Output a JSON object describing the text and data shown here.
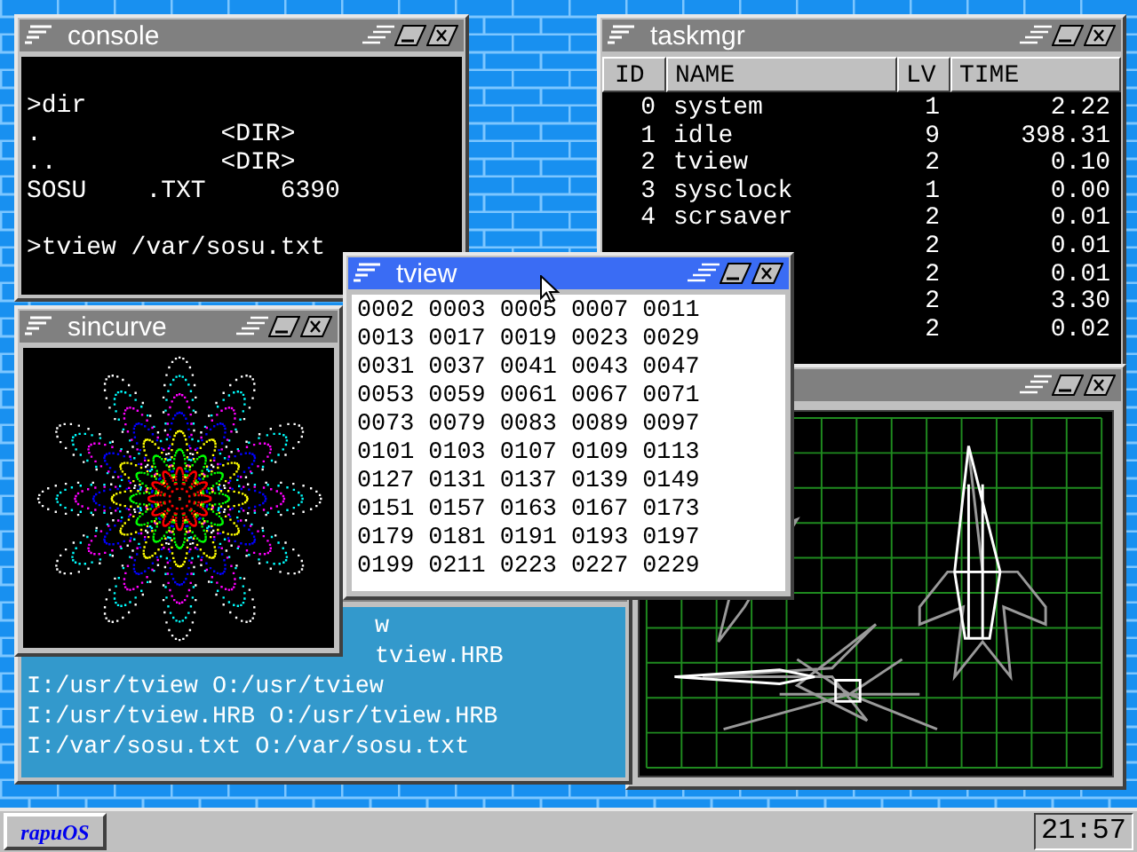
{
  "windows": [
    {
      "kind": "console",
      "title": "console",
      "active": false,
      "blocks": [
        [
          ">dir",
          ".            <DIR>",
          "..           <DIR>",
          "SOSU    .TXT     6390"
        ],
        [
          ">tview /var/sosu.txt"
        ]
      ]
    },
    {
      "kind": "sincurve",
      "title": "sincurve",
      "active": false
    },
    {
      "kind": "log",
      "active": false,
      "lines": [
        {
          "kind": "clipped",
          "text": "w"
        },
        {
          "kind": "clipped",
          "text": "tview.HRB"
        },
        {
          "kind": "full",
          "text": "I:/usr/tview O:/usr/tview"
        },
        {
          "kind": "full",
          "text": "I:/usr/tview.HRB O:/usr/tview.HRB"
        },
        {
          "kind": "full",
          "text": "I:/var/sosu.txt O:/var/sosu.txt"
        }
      ]
    },
    {
      "kind": "tview",
      "title": "tview",
      "active": true,
      "rows": [
        [
          "0002",
          "0003",
          "0005",
          "0007",
          "0011"
        ],
        [
          "0013",
          "0017",
          "0019",
          "0023",
          "0029"
        ],
        [
          "0031",
          "0037",
          "0041",
          "0043",
          "0047"
        ],
        [
          "0053",
          "0059",
          "0061",
          "0067",
          "0071"
        ],
        [
          "0073",
          "0079",
          "0083",
          "0089",
          "0097"
        ],
        [
          "0101",
          "0103",
          "0107",
          "0109",
          "0113"
        ],
        [
          "0127",
          "0131",
          "0137",
          "0139",
          "0149"
        ],
        [
          "0151",
          "0157",
          "0163",
          "0167",
          "0173"
        ],
        [
          "0179",
          "0181",
          "0191",
          "0193",
          "0197"
        ],
        [
          "0199",
          "0211",
          "0223",
          "0227",
          "0229"
        ]
      ]
    },
    {
      "kind": "taskmgr",
      "title": "taskmgr",
      "active": false,
      "columns": [
        "ID",
        "NAME",
        "LV",
        "TIME"
      ],
      "rows": [
        {
          "id": "0",
          "name": "system",
          "lv": "1",
          "time": "2.22"
        },
        {
          "id": "1",
          "name": "idle",
          "lv": "9",
          "time": "398.31"
        },
        {
          "id": "2",
          "name": "tview",
          "lv": "2",
          "time": "0.10"
        },
        {
          "id": "3",
          "name": "sysclock",
          "lv": "1",
          "time": "0.00"
        },
        {
          "id": "4",
          "name": "scrsaver",
          "lv": "2",
          "time": "0.01"
        },
        {
          "lv": "2",
          "time": "0.01"
        },
        {
          "lv": "2",
          "time": "0.01"
        },
        {
          "lv": "2",
          "time": "3.30"
        },
        {
          "lv": "2",
          "time": "0.02"
        }
      ]
    },
    {
      "kind": "viewer3d",
      "active": false
    }
  ],
  "taskbar": {
    "start_button": "rapuOS",
    "clock": "21:57"
  }
}
